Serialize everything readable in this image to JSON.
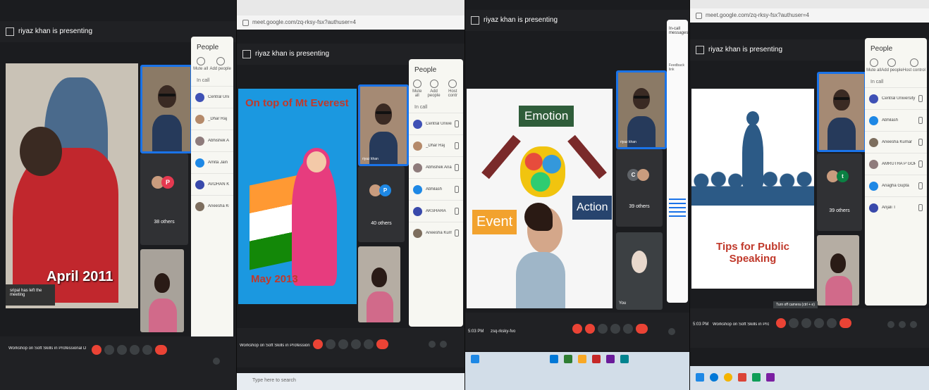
{
  "panels": [
    {
      "presenter": "riyaz khan is presenting",
      "slide_caption": "April 2011",
      "toast": "sripal has left the meeting",
      "people_title": "People",
      "actions": [
        "Mute all",
        "Add people"
      ],
      "in_call": "In call",
      "participants": [
        "Central University o...",
        "_Dhar Raj",
        "Abhishek Anand",
        "Amita Jain",
        "AVDHAN K",
        "Aneesha Kumar"
      ],
      "others": "38 others",
      "avatar_letter": "P",
      "meeting_title": "Workshop on Soft Skills in Professional Deve..."
    },
    {
      "url": "meet.google.com/zq-rksy-fsx?authuser=4",
      "presenter": "riyaz khan is presenting",
      "slide_title": "On top of Mt Everest",
      "slide_caption": "May 2013",
      "people_title": "People",
      "actions": [
        "Mute all",
        "Add people",
        "Host contr"
      ],
      "in_call": "In call",
      "participants": [
        "Central University o... (You)",
        "_Dhar Raj",
        "Abhishek Anand",
        "Abhilash",
        "AKSHARA",
        "Aneesha Kumar"
      ],
      "others": "40 others",
      "avatar_letter": "P",
      "tile_label": "riyaz khan",
      "meeting_title": "Workshop on Soft Skills in Professional Deve...",
      "taskbar_search": "Type here to search"
    },
    {
      "presenter": "riyaz khan is presenting",
      "words": [
        "Emotion",
        "Event",
        "Action"
      ],
      "tile_label": "riyaz khan",
      "others": "39 others",
      "avatar_letter": "C",
      "self_label": "You",
      "chat_header": "In-call messages",
      "chat_lines": [
        "Feedback link"
      ],
      "time": "5:03 PM",
      "meeting_code": "zsq-rksky-fvo"
    },
    {
      "url": "meet.google.com/zq-rksy-fsx?authuser=4",
      "presenter": "riyaz khan is presenting",
      "slide_title": "Tips for Public Speaking",
      "people_title": "People",
      "actions": [
        "Mute all",
        "Add people",
        "Host control"
      ],
      "in_call": "In call",
      "participants": [
        "Central University o... (You)",
        "Abhilash",
        "Aneesha Kumar",
        "AMRUTHA P GOPALAKR...",
        "Anagha Gupta",
        "Anjali T"
      ],
      "others": "39 others",
      "avatar_letter": "t",
      "time": "5:03 PM",
      "meeting_title": "Workshop on Soft Skills in Professional Deve...",
      "tooltip": "Turn off camera (ctrl + e)"
    }
  ],
  "colors": {
    "meet_dark": "#202124",
    "end_call_red": "#ea4335",
    "highlight_blue": "#1a73e8",
    "emotion_green": "#2f5d3a",
    "action_navy": "#27446e",
    "event_orange": "#f2a22e",
    "title_red": "#c0392b"
  }
}
